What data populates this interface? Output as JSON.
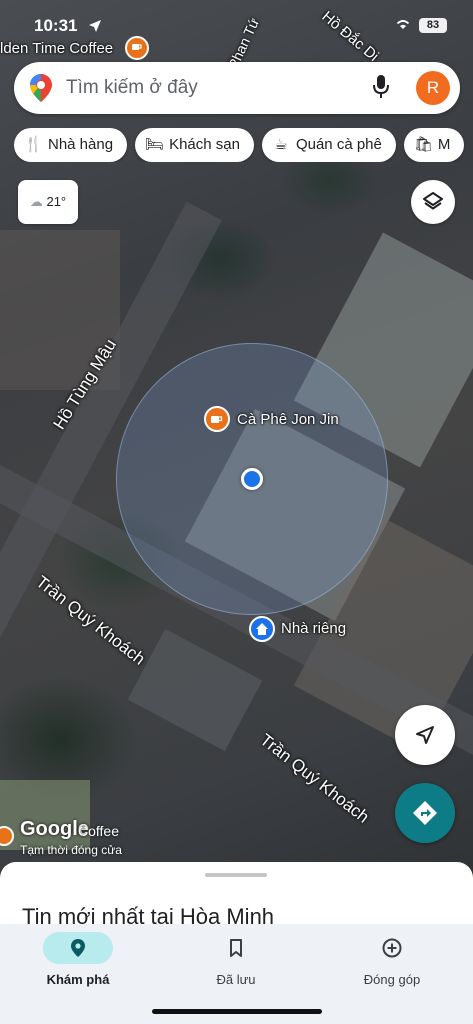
{
  "status_bar": {
    "time": "10:31",
    "battery": "83"
  },
  "search": {
    "placeholder": "Tìm kiếm ở đây",
    "avatar_letter": "R"
  },
  "chips": [
    {
      "icon": "restaurant-icon",
      "label": "Nhà hàng"
    },
    {
      "icon": "hotel-icon",
      "label": "Khách sạn"
    },
    {
      "icon": "coffee-icon",
      "label": "Quán cà phê"
    },
    {
      "icon": "shopping-bag-icon",
      "label": "M"
    }
  ],
  "weather": {
    "icon": "cloud-icon",
    "temp": "21°"
  },
  "map": {
    "top_poi": "lden Time Coffee",
    "top_street": "Hồ Đắc Di",
    "pois": [
      {
        "name": "Cà Phê Jon Jin",
        "icon": "coffee-icon"
      },
      {
        "name": "Nhà riêng",
        "icon": "home-icon"
      }
    ],
    "streets": [
      "Hồ Tùng Mậu",
      "Trần Quý Khoách",
      "Trần Quý Khoách",
      "Phan Tứ"
    ],
    "attribution": "Google",
    "bottom_poi": "Coffee",
    "bottom_poi_status": "Tạm thời đóng cửa"
  },
  "sheet": {
    "title": "Tin mới nhất tại Hòa Minh"
  },
  "bottom_nav": [
    {
      "label": "Khám phá",
      "icon": "explore-pin-icon",
      "active": true
    },
    {
      "label": "Đã lưu",
      "icon": "bookmark-icon",
      "active": false
    },
    {
      "label": "Đóng góp",
      "icon": "add-circle-icon",
      "active": false
    }
  ],
  "colors": {
    "accent": "#1a73e8",
    "directions_fab": "#0e7c86",
    "avatar": "#f26c1f",
    "active_pill": "#b7ebee"
  }
}
